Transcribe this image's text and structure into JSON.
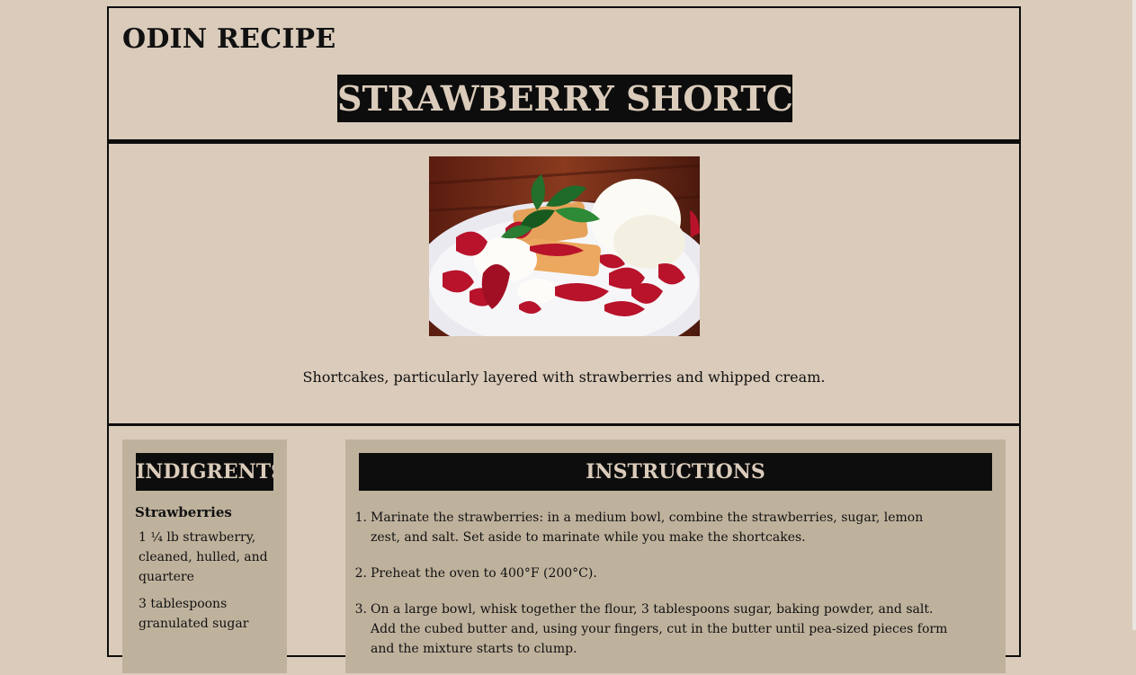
{
  "site": {
    "title": "ODIN RECIPE"
  },
  "recipe": {
    "title": "STRAWBERRY SHORTCAKE",
    "image_alt": "strawberry shortcake with whipped cream and mint",
    "description": "Shortcakes, particularly layered with strawberries and whipped cream."
  },
  "ingredients": {
    "heading": "INDIGRENTS",
    "group_title": "Strawberries",
    "items": [
      "1 ¼ lb strawberry, cleaned, hulled, and quartere",
      "3 tablespoons granulated sugar"
    ]
  },
  "instructions": {
    "heading": "INSTRUCTIONS",
    "steps": [
      {
        "num": "1.",
        "text": "Marinate the strawberries: in a medium bowl, combine the strawberries, sugar, lemon zest, and salt. Set aside to marinate while you make the shortcakes."
      },
      {
        "num": "2.",
        "text": "Preheat the oven to 400°F (200°C)."
      },
      {
        "num": "3.",
        "text": "On a large bowl, whisk together the flour, 3 tablespoons sugar, baking powder, and salt. Add the cubed butter and, using your fingers, cut in the butter until pea-sized pieces form and the mixture starts to clump."
      }
    ]
  },
  "colors": {
    "background": "#dacbba",
    "panel": "#bfb29d",
    "dark": "#0d0d0d"
  }
}
